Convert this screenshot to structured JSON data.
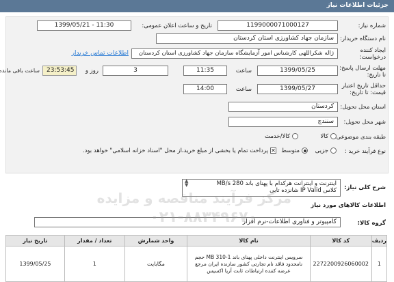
{
  "page": {
    "title": "جزئیات اطلاعات نیاز"
  },
  "form": {
    "need_number_label": "شماره نیاز:",
    "need_number": "1199000071000127",
    "announce_label": "تاریخ و ساعت اعلان عمومی:",
    "announce_value": "1399/05/21 - 11:30",
    "buyer_label": "نام دستگاه خریدار:",
    "buyer_value": "سازمان جهاد کشاورزی استان کردستان",
    "creator_label": "ایجاد کننده درخواست:",
    "creator_value": "ژاله شکراللهی کارشناس امور آزمایشگاه سازمان جهاد کشاورزی استان کردستان",
    "contact_link": "اطلاعات تماس خریدار",
    "reply_deadline_label": "مهلت ارسال پاسخ: تا تاریخ:",
    "reply_date": "1399/05/25",
    "time_label": "ساعت",
    "reply_time": "11:35",
    "days_value": "3",
    "days_label": "روز و",
    "remaining_time": "23:53:45",
    "remaining_label": "ساعت باقی مانده",
    "validity_label": "حداقل تاریخ اعتبار قیمت: تا تاریخ:",
    "validity_date": "1399/05/27",
    "validity_time": "14:00",
    "province_label": "استان محل تحویل:",
    "province_value": "کردستان",
    "city_label": "شهر محل تحویل:",
    "city_value": "سنندج",
    "category_label": "طبقه بندی موضوعی:",
    "category_options": [
      "کالا",
      "کالا/خدمت"
    ],
    "process_label": "نوع فرآیند خرید :",
    "process_options": [
      "جزیی",
      "متوسط"
    ],
    "payment_note": "پرداخت تمام یا بخشی از مبلغ خرید،از محل \"اسناد خزانه اسلامی\" خواهد بود."
  },
  "summary": {
    "label": "شرح کلی نیاز:",
    "line1": "اینترنت و اینترانت هرکدام با پهنای باند MB/s 280",
    "line2": "کلاس IP Valid شانزده تایی"
  },
  "goods": {
    "section_title": "اطلاعات کالاهای مورد نیاز",
    "group_label": "گروه کالا:",
    "group_value": "کامپیوتر و فناوری اطلاعات-نرم افزار",
    "columns": [
      "ردیف",
      "کد کالا",
      "نام کالا",
      "واحد شمارش",
      "تعداد / مقدار",
      "تاریخ نیاز"
    ],
    "rows": [
      {
        "row": "1",
        "code": "2272200926060002",
        "name": "سرویس اینترنت داخلی پهنای باند 1-MB 310 حجم نامحدود فاقد نام تجارتی کشور سازنده ایران مرجع عرضه کننده ارتباطات ثابت آریا اکسیس",
        "unit": "مگابایت",
        "qty": "1",
        "date": "1399/05/25"
      }
    ]
  },
  "watermark": {
    "line1": "مرکز فرآیند مناقصه و مزایده",
    "line2": "۰۲۱-۸۸۳۴۹۶۷۰"
  }
}
